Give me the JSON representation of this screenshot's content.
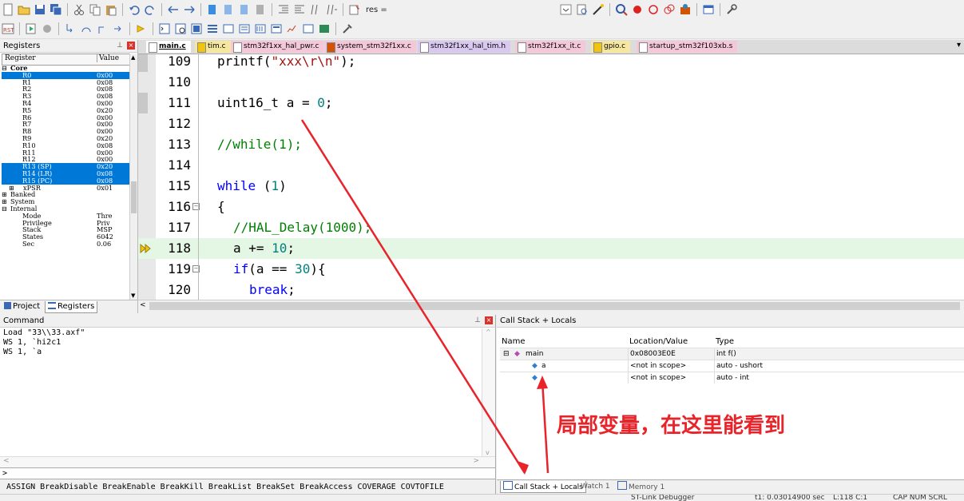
{
  "toolbar": {
    "watch_expr": "res ="
  },
  "registers": {
    "title": "Registers",
    "col_register": "Register",
    "col_value": "Value",
    "rows": [
      {
        "name": "Core",
        "value": "",
        "indent": 0,
        "sel": false,
        "bold": true,
        "expander": "−"
      },
      {
        "name": "R0",
        "value": "0x00",
        "indent": 2,
        "sel": true
      },
      {
        "name": "R1",
        "value": "0x08",
        "indent": 2,
        "sel": false
      },
      {
        "name": "R2",
        "value": "0x08",
        "indent": 2,
        "sel": false
      },
      {
        "name": "R3",
        "value": "0x08",
        "indent": 2,
        "sel": false
      },
      {
        "name": "R4",
        "value": "0x00",
        "indent": 2,
        "sel": false
      },
      {
        "name": "R5",
        "value": "0x20",
        "indent": 2,
        "sel": false
      },
      {
        "name": "R6",
        "value": "0x00",
        "indent": 2,
        "sel": false
      },
      {
        "name": "R7",
        "value": "0x00",
        "indent": 2,
        "sel": false
      },
      {
        "name": "R8",
        "value": "0x00",
        "indent": 2,
        "sel": false
      },
      {
        "name": "R9",
        "value": "0x20",
        "indent": 2,
        "sel": false
      },
      {
        "name": "R10",
        "value": "0x08",
        "indent": 2,
        "sel": false
      },
      {
        "name": "R11",
        "value": "0x00",
        "indent": 2,
        "sel": false
      },
      {
        "name": "R12",
        "value": "0x00",
        "indent": 2,
        "sel": false
      },
      {
        "name": "R13 (SP)",
        "value": "0x20",
        "indent": 2,
        "sel": true
      },
      {
        "name": "R14 (LR)",
        "value": "0x08",
        "indent": 2,
        "sel": true
      },
      {
        "name": "R15 (PC)",
        "value": "0x08",
        "indent": 2,
        "sel": true
      },
      {
        "name": "xPSR",
        "value": "0x01",
        "indent": 2,
        "sel": false,
        "expander": "+"
      },
      {
        "name": "Banked",
        "value": "",
        "indent": 0,
        "sel": false,
        "expander": "+"
      },
      {
        "name": "System",
        "value": "",
        "indent": 0,
        "sel": false,
        "expander": "+"
      },
      {
        "name": "Internal",
        "value": "",
        "indent": 0,
        "sel": false,
        "expander": "−"
      },
      {
        "name": "Mode",
        "value": "Thre",
        "indent": 2,
        "sel": false
      },
      {
        "name": "Privilege",
        "value": "Priv",
        "indent": 2,
        "sel": false
      },
      {
        "name": "Stack",
        "value": "MSP",
        "indent": 2,
        "sel": false
      },
      {
        "name": "States",
        "value": "6042",
        "indent": 2,
        "sel": false
      },
      {
        "name": "Sec",
        "value": "0.06",
        "indent": 2,
        "sel": false
      }
    ],
    "tab_project": "Project",
    "tab_registers": "Registers"
  },
  "editor": {
    "tabs": [
      "main.c",
      "tim.c",
      "stm32f1xx_hal_pwr.c",
      "system_stm32f1xx.c",
      "stm32f1xx_hal_tim.h",
      "stm32f1xx_it.c",
      "gpio.c",
      "startup_stm32f103xb.s"
    ],
    "lines": [
      {
        "n": "109",
        "parts": [
          {
            "t": "printf(",
            "c": ""
          },
          {
            "t": "\"xxx\\r\\n\"",
            "c": "str"
          },
          {
            "t": ");",
            "c": ""
          }
        ],
        "indent": 0,
        "bp": true
      },
      {
        "n": "110",
        "parts": [],
        "indent": 0
      },
      {
        "n": "111",
        "parts": [
          {
            "t": "uint16_t a = ",
            "c": ""
          },
          {
            "t": "0",
            "c": "num"
          },
          {
            "t": ";",
            "c": ""
          }
        ],
        "indent": 0,
        "bp": true
      },
      {
        "n": "112",
        "parts": [],
        "indent": 0
      },
      {
        "n": "113",
        "parts": [
          {
            "t": "//while(1);",
            "c": "cmt"
          }
        ],
        "indent": 0
      },
      {
        "n": "114",
        "parts": [],
        "indent": 0
      },
      {
        "n": "115",
        "parts": [
          {
            "t": "while",
            "c": "kw"
          },
          {
            "t": " (",
            "c": ""
          },
          {
            "t": "1",
            "c": "num"
          },
          {
            "t": ")",
            "c": ""
          }
        ],
        "indent": 0
      },
      {
        "n": "116",
        "parts": [
          {
            "t": "{",
            "c": ""
          }
        ],
        "indent": 0,
        "fold": true
      },
      {
        "n": "117",
        "parts": [
          {
            "t": "//HAL_Delay(1000);",
            "c": "cmt"
          }
        ],
        "indent": 1
      },
      {
        "n": "118",
        "parts": [
          {
            "t": "a += ",
            "c": ""
          },
          {
            "t": "10",
            "c": "num"
          },
          {
            "t": ";",
            "c": ""
          }
        ],
        "indent": 1,
        "current": true
      },
      {
        "n": "119",
        "parts": [
          {
            "t": "if",
            "c": "kw"
          },
          {
            "t": "(a == ",
            "c": ""
          },
          {
            "t": "30",
            "c": "num"
          },
          {
            "t": "){",
            "c": ""
          }
        ],
        "indent": 1,
        "fold": true
      },
      {
        "n": "120",
        "parts": [
          {
            "t": "break",
            "c": "kw"
          },
          {
            "t": ";",
            "c": ""
          }
        ],
        "indent": 2
      }
    ]
  },
  "command": {
    "title": "Command",
    "output": [
      "Load \"33\\\\33.axf\"",
      "WS 1, `hi2c1",
      "WS 1, `a"
    ],
    "prompt": ">",
    "help": "ASSIGN BreakDisable BreakEnable BreakKill BreakList BreakSet BreakAccess COVERAGE COVTOFILE"
  },
  "callstack": {
    "title": "Call Stack + Locals",
    "col_name": "Name",
    "col_location": "Location/Value",
    "col_type": "Type",
    "rows": [
      {
        "name": "main",
        "value": "0x08003E0E",
        "type": "int f()"
      },
      {
        "name": "a",
        "value": "<not in scope>",
        "type": "auto - ushort"
      },
      {
        "name": "",
        "value": "<not in scope>",
        "type": "auto - int"
      }
    ],
    "tab_callstack": "Call Stack + Locals",
    "tab_watch": "Watch 1",
    "tab_memory": "Memory 1"
  },
  "annotation": "局部变量，在这里能看到",
  "status": {
    "debugger": "ST-Link Debugger",
    "time": "t1: 0.03014900 sec",
    "position": "L:118 C:1",
    "flags": "CAP NUM SCRL OVR"
  },
  "colors": {
    "selection": "#0078d7",
    "current_line": "#e4f7e4",
    "annotation": "#e8232a",
    "keyword": "#0000ff",
    "number": "#008080"
  }
}
